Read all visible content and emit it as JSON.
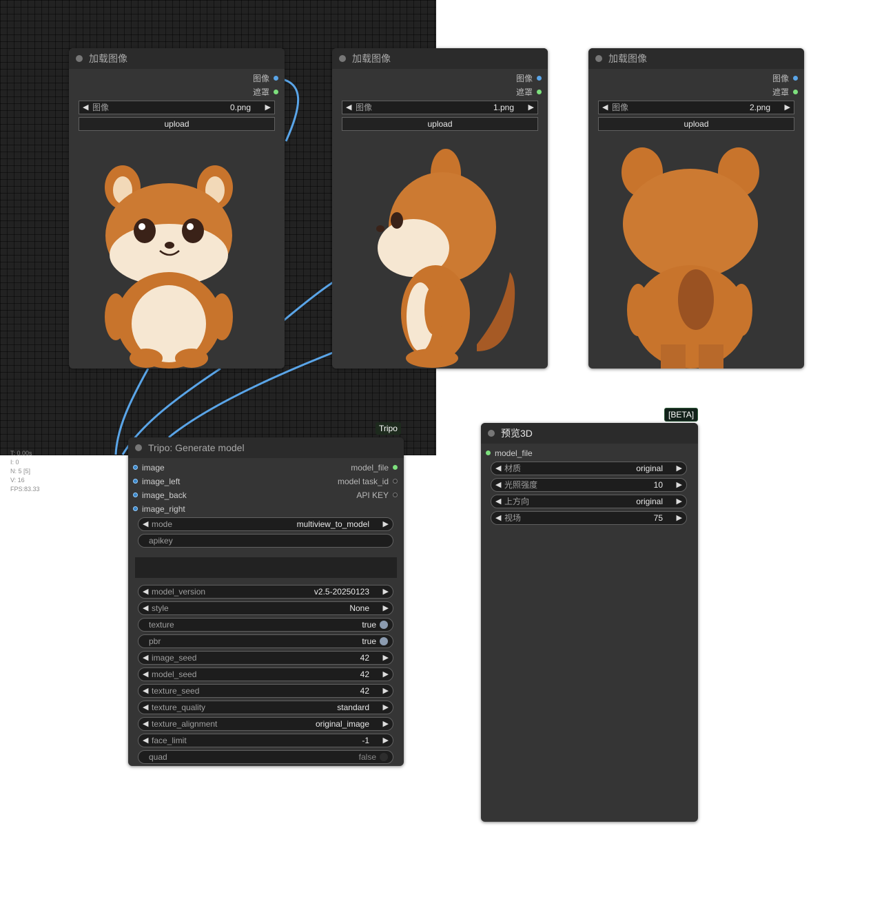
{
  "canvas_stats": {
    "t": "T: 0.00s",
    "i": "I: 0",
    "n": "N: 5 [5]",
    "v": "V: 16",
    "fps": "FPS:83.33"
  },
  "load_nodes": [
    {
      "title": "加载图像",
      "out_image": "图像",
      "out_mask": "遮罩",
      "widget_label": "图像",
      "file": "0.png",
      "upload": "upload",
      "view": "front"
    },
    {
      "title": "加载图像",
      "out_image": "图像",
      "out_mask": "遮罩",
      "widget_label": "图像",
      "file": "1.png",
      "upload": "upload",
      "view": "side"
    },
    {
      "title": "加载图像",
      "out_image": "图像",
      "out_mask": "遮罩",
      "widget_label": "图像",
      "file": "2.png",
      "upload": "upload",
      "view": "back"
    }
  ],
  "tripo_node": {
    "badge": "Tripo",
    "title": "Tripo: Generate model",
    "inputs": [
      "image",
      "image_left",
      "image_back",
      "image_right"
    ],
    "outputs": [
      "model_file",
      "model task_id",
      "API KEY"
    ],
    "mode": {
      "label": "mode",
      "value": "multiview_to_model"
    },
    "apikey": {
      "label": "apikey"
    },
    "widgets": [
      {
        "label": "model_version",
        "value": "v2.5-20250123",
        "kind": "combo"
      },
      {
        "label": "style",
        "value": "None",
        "kind": "combo"
      },
      {
        "label": "texture",
        "value": "true",
        "kind": "toggle",
        "on": true
      },
      {
        "label": "pbr",
        "value": "true",
        "kind": "toggle",
        "on": true
      },
      {
        "label": "image_seed",
        "value": "42",
        "kind": "number"
      },
      {
        "label": "model_seed",
        "value": "42",
        "kind": "number"
      },
      {
        "label": "texture_seed",
        "value": "42",
        "kind": "number"
      },
      {
        "label": "texture_quality",
        "value": "standard",
        "kind": "combo"
      },
      {
        "label": "texture_alignment",
        "value": "original_image",
        "kind": "combo"
      },
      {
        "label": "face_limit",
        "value": "-1",
        "kind": "number"
      },
      {
        "label": "quad",
        "value": "false",
        "kind": "toggle",
        "on": false
      }
    ]
  },
  "preview_node": {
    "badge": "[BETA]",
    "title": "预览3D",
    "input": "model_file",
    "widgets": [
      {
        "label": "材质",
        "value": "original"
      },
      {
        "label": "光照强度",
        "value": "10"
      },
      {
        "label": "上方向",
        "value": "original"
      },
      {
        "label": "视场",
        "value": "75"
      }
    ]
  },
  "colors": {
    "canvas": "#222222",
    "node_body": "#353535",
    "node_title": "#2b2b2b",
    "link": "#5aa5e8",
    "socket_image": "#5aa5e8",
    "socket_mask": "#7de07d",
    "character_fur": "#c8742c",
    "character_belly": "#f5e6cf"
  }
}
